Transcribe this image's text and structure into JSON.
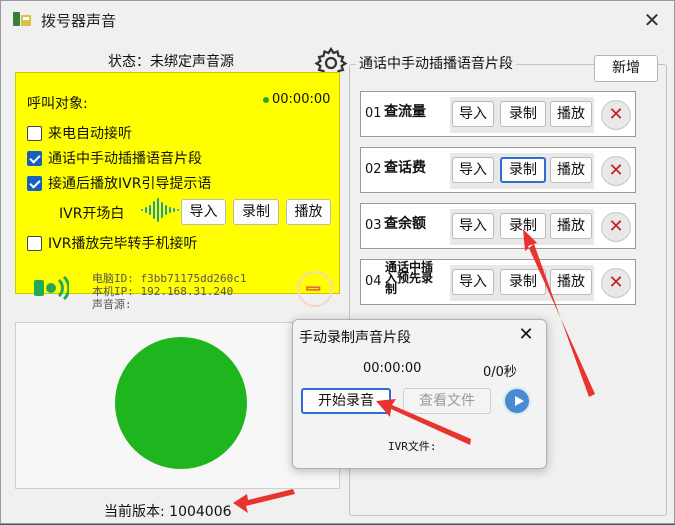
{
  "window": {
    "title": "拨号器声音"
  },
  "left": {
    "status": "状态：未绑定声音源",
    "call_target_label": "呼叫对象:",
    "call_timer": "00:00:00",
    "options": [
      {
        "label": "来电自动接听",
        "checked": false
      },
      {
        "label": "通话中手动插播语音片段",
        "checked": true
      },
      {
        "label": "接通后播放IVR引导提示语",
        "checked": true
      }
    ],
    "ivr_open_label": "IVR开场白",
    "ivr_buttons": {
      "import": "导入",
      "record": "录制",
      "play": "播放"
    },
    "ivr_forward_option": {
      "label": "IVR播放完毕转手机接听",
      "checked": false
    },
    "pc_id": "电脑ID: f3bb71175dd260c1",
    "local_ip": "本机IP: 192.168.31.240",
    "sound_source": "声音源:",
    "version": "当前版本: 1004006"
  },
  "right": {
    "group_title": "通话中手动插播语音片段",
    "add_button": "新增",
    "rows": [
      {
        "num": "01",
        "name": "查流量",
        "import": "导入",
        "record": "录制",
        "play": "播放"
      },
      {
        "num": "02",
        "name": "查话费",
        "import": "导入",
        "record": "录制",
        "play": "播放"
      },
      {
        "num": "03",
        "name": "查余额",
        "import": "导入",
        "record": "录制",
        "play": "播放"
      },
      {
        "num": "04",
        "name": "通话中插入预先录制",
        "import": "导入",
        "record": "录制",
        "play": "播放"
      }
    ]
  },
  "dialog": {
    "title": "手动录制声音片段",
    "time": "00:00:00",
    "count": "0/0秒",
    "start_button": "开始录音",
    "view_button": "查看文件",
    "ivr_file_label": "IVR文件:"
  },
  "colors": {
    "highlight": "#ffff00",
    "status_green": "#1fb51f",
    "delete_red": "#c0202a",
    "arrow_red": "#e8332f"
  }
}
